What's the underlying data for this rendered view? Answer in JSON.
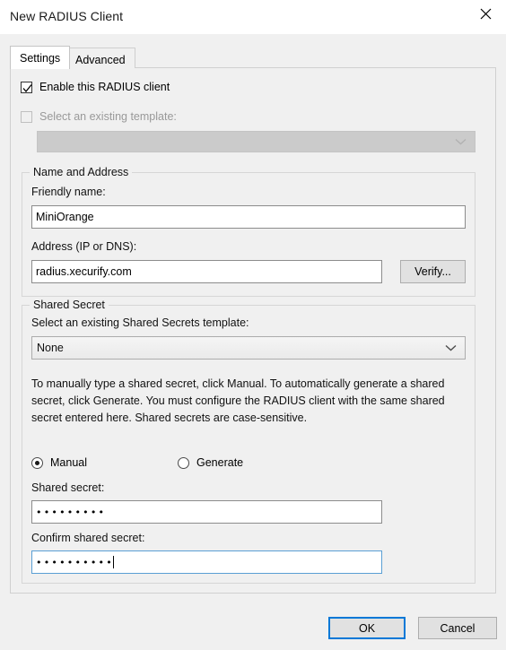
{
  "window": {
    "title": "New RADIUS Client",
    "close_icon": "close-icon"
  },
  "tabs": [
    {
      "label": "Settings",
      "active": true
    },
    {
      "label": "Advanced",
      "active": false
    }
  ],
  "settings": {
    "enable_client": {
      "label": "Enable this RADIUS client",
      "checked": true,
      "enabled": true
    },
    "select_template": {
      "label": "Select an existing template:",
      "checked": false,
      "enabled": false
    },
    "template_combo": {
      "value": "",
      "enabled": false,
      "chevron_icon": "chevron-down-icon"
    },
    "name_and_address": {
      "title": "Name and Address",
      "friendly_name_label": "Friendly name:",
      "friendly_name_value": "MiniOrange",
      "address_label": "Address (IP or DNS):",
      "address_value": "radius.xecurify.com",
      "verify_button": "Verify..."
    },
    "shared_secret": {
      "title": "Shared Secret",
      "template_label": "Select an existing Shared Secrets template:",
      "template_value": "None",
      "chevron_icon": "chevron-down-icon",
      "help_text": "To manually type a shared secret, click Manual. To automatically generate a shared secret, click Generate. You must configure the RADIUS client with the same shared secret entered here. Shared secrets are case-sensitive.",
      "mode_manual": "Manual",
      "mode_generate": "Generate",
      "selected_mode": "Manual",
      "secret_label": "Shared secret:",
      "secret_value": "•••••••••",
      "confirm_label": "Confirm shared secret:",
      "confirm_value": "••••••••••",
      "confirm_focused": true
    }
  },
  "footer": {
    "ok_label": "OK",
    "cancel_label": "Cancel"
  },
  "colors": {
    "accent": "#0078d7",
    "focus_border": "#5a9fd4",
    "dialog_bg": "#f0f0f0",
    "panel_bg": "#ffffff"
  }
}
